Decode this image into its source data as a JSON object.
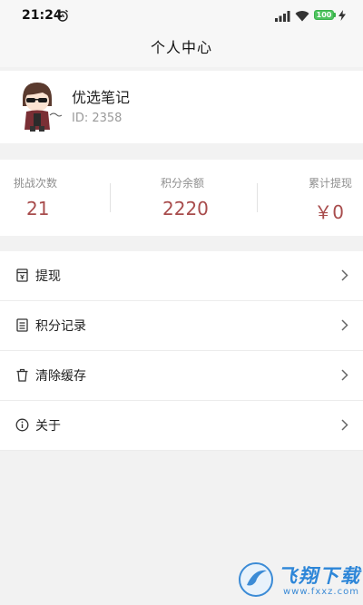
{
  "status_bar": {
    "time": "21:24",
    "battery": "100",
    "icons": [
      "alarm-icon",
      "signal-icon",
      "wifi-icon",
      "battery-icon",
      "charging-icon"
    ]
  },
  "header": {
    "title": "个人中心"
  },
  "profile": {
    "name": "优选笔记",
    "id": "ID: 2358"
  },
  "stats": [
    {
      "label": "挑战次数",
      "value": "21"
    },
    {
      "label": "积分余额",
      "value": "2220"
    },
    {
      "label": "累计提现",
      "value": "￥0"
    }
  ],
  "menu": [
    {
      "label": "提现",
      "icon": "withdraw-icon"
    },
    {
      "label": "积分记录",
      "icon": "list-icon"
    },
    {
      "label": "清除缓存",
      "icon": "trash-icon"
    },
    {
      "label": "关于",
      "icon": "info-icon"
    }
  ],
  "watermark": {
    "title": "飞翔下载",
    "url": "www.fxxz.com"
  },
  "colors": {
    "accent": "#a84c4c",
    "background": "#f2f2f2",
    "battery": "#4fc35f"
  }
}
